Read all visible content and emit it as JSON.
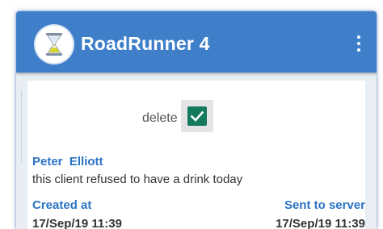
{
  "app": {
    "title": "RoadRunner 4",
    "logo_icon": "hourglass-icon",
    "menu_icon": "more-vertical-icon",
    "colors": {
      "app_bar": "#3f7fc9",
      "accent_blue": "#2a73c3",
      "checkbox": "#137a5e"
    }
  },
  "record": {
    "delete_label": "delete",
    "delete_checked": true,
    "client_name": "Peter  Elliott",
    "note": "this client refused to have a drink today",
    "created_label": "Created at",
    "created_value": "17/Sep/19 11:39",
    "sent_label": "Sent to server",
    "sent_value": "17/Sep/19 11:39"
  }
}
